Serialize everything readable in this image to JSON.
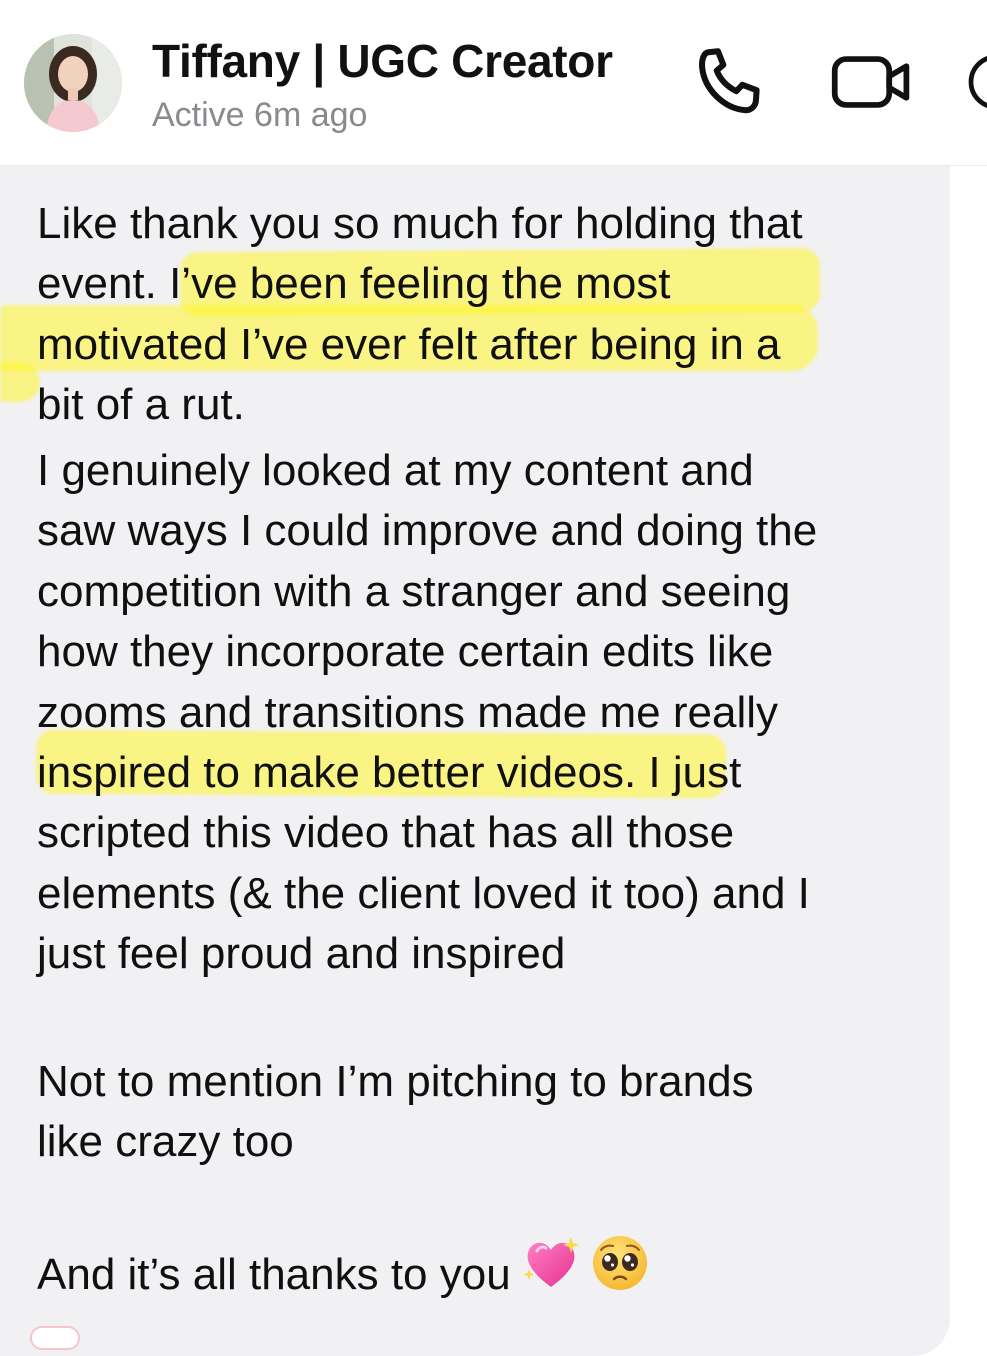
{
  "header": {
    "contact_name": "Tiffany | UGC Creator",
    "status": "Active 6m ago",
    "call_icon": "phone-icon",
    "video_icon": "video-camera-icon",
    "info_icon": "info-icon"
  },
  "message": {
    "paragraph1": [
      "Like thank you so much for holding that",
      "event. I’ve been feeling the most",
      "motivated I’ve ever felt after being in a",
      "bit of a rut."
    ],
    "paragraph2": [
      "I genuinely looked at my content and",
      "saw ways I could improve and doing the",
      "competition with a stranger and seeing",
      "how they incorporate certain edits like",
      "zooms and transitions made me really",
      "inspired to make better videos. I just",
      "scripted this video that has all those",
      "elements (& the client loved it too) and I",
      "just feel proud and inspired"
    ],
    "paragraph3": [
      "Not to mention I’m pitching to brands",
      "like crazy too"
    ],
    "paragraph4": "And it’s all thanks to you",
    "emojis": [
      "sparkling-heart-icon",
      "pleading-face-icon"
    ]
  },
  "colors": {
    "bubble_background": "#f1f1f4",
    "highlight": "#fff628",
    "status_text": "#8a8a8e",
    "text": "#101010"
  }
}
